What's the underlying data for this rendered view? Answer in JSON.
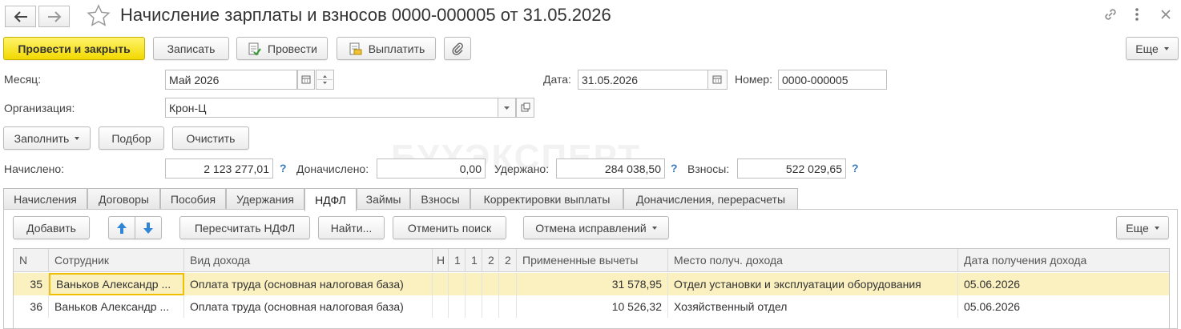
{
  "header": {
    "title": "Начисление зарплаты и взносов 0000-000005 от 31.05.2026"
  },
  "toolbar": {
    "post_close": "Провести и закрыть",
    "save": "Записать",
    "post": "Провести",
    "pay": "Выплатить",
    "more": "Еще"
  },
  "form": {
    "month_label": "Месяц:",
    "month_value": "Май 2026",
    "date_label": "Дата:",
    "date_value": "31.05.2026",
    "number_label": "Номер:",
    "number_value": "0000-000005",
    "org_label": "Организация:",
    "org_value": "Крон-Ц",
    "fill": "Заполнить",
    "select": "Подбор",
    "clear": "Очистить",
    "accrued_label": "Начислено:",
    "accrued_value": "2 123 277,01",
    "additional_label": "Доначислено:",
    "additional_value": "0,00",
    "withheld_label": "Удержано:",
    "withheld_value": "284 038,50",
    "contrib_label": "Взносы:",
    "contrib_value": "522 029,65",
    "help": "?"
  },
  "watermark": "БУХЭКСПЕРТ",
  "tabs": [
    {
      "label": "Начисления"
    },
    {
      "label": "Договоры"
    },
    {
      "label": "Пособия"
    },
    {
      "label": "Удержания"
    },
    {
      "label": "НДФЛ"
    },
    {
      "label": "Займы"
    },
    {
      "label": "Взносы"
    },
    {
      "label": "Корректировки выплаты"
    },
    {
      "label": "Доначисления, перерасчеты"
    }
  ],
  "panel_toolbar": {
    "add": "Добавить",
    "recalc": "Пересчитать НДФЛ",
    "find": "Найти...",
    "cancel_search": "Отменить поиск",
    "cancel_corrections": "Отмена исправлений",
    "more": "Еще"
  },
  "table": {
    "headers": [
      "N",
      "Сотрудник",
      "Вид дохода",
      "Н",
      "1",
      "1",
      "2",
      "2",
      "Примененные вычеты",
      "Место получ. дохода",
      "Дата получения дохода"
    ],
    "rows": [
      {
        "n": "35",
        "employee": "Ваньков Александр ...",
        "income": "Оплата труда (основная налоговая база)",
        "deductions": "31 578,95",
        "place": "Отдел установки и эксплуатации оборудования",
        "date": "05.06.2026"
      },
      {
        "n": "36",
        "employee": "Ваньков Александр ...",
        "income": "Оплата труда (основная налоговая база)",
        "deductions": "10 526,32",
        "place": "Хозяйственный отдел",
        "date": "05.06.2026"
      }
    ]
  },
  "icons": {
    "back": "arrow-left",
    "forward": "arrow-right",
    "star": "star",
    "link": "link",
    "menu": "vertical-dots",
    "close": "close"
  }
}
